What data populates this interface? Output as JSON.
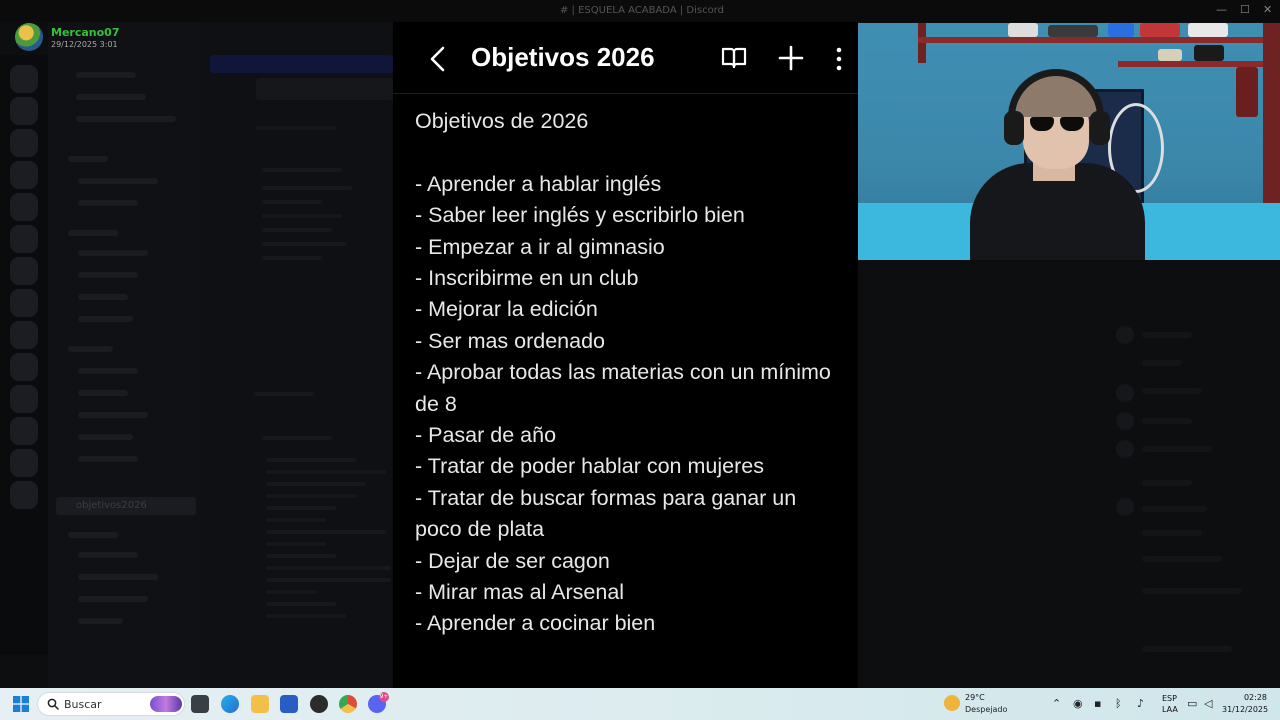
{
  "window": {
    "title": "# | ESQUELA ACABADA | Discord",
    "minimize": "—",
    "maximize": "☐",
    "close": "✕"
  },
  "user": {
    "name": "Mercano07",
    "timestamp": "29/12/2025 3:01"
  },
  "notes_app": {
    "title": "Objetivos 2026",
    "icons": [
      "back-arrow-icon",
      "book-icon",
      "plus-icon",
      "more-vertical-icon"
    ],
    "heading": "Objetivos de 2026",
    "items": [
      "- Aprender a hablar inglés",
      "- Saber leer inglés y escribirlo bien",
      "- Empezar a ir al gimnasio",
      "- Inscribirme en un club",
      "- Mejorar la edición",
      "- Ser mas ordenado",
      "- Aprobar todas las materias con un mínimo de 8",
      "- Pasar de año",
      "- Tratar de poder hablar con mujeres",
      "- Tratar de buscar formas para ganar un poco de plata",
      "- Dejar de ser cagon",
      "- Mirar mas al Arsenal",
      "- Aprender a cocinar bien"
    ]
  },
  "background_app": {
    "selected_channel": "objetivos2026"
  },
  "taskbar": {
    "search_placeholder": "Buscar",
    "weather_temp": "29°C",
    "weather_desc": "Despejado",
    "lang_line1": "ESP",
    "lang_line2": "LAA",
    "time": "02:28",
    "date": "31/12/2025",
    "discord_badge": "9+"
  },
  "colors": {
    "username": "#35c23a",
    "taskbar": "#dcecef",
    "notes_bg": "#000000"
  }
}
